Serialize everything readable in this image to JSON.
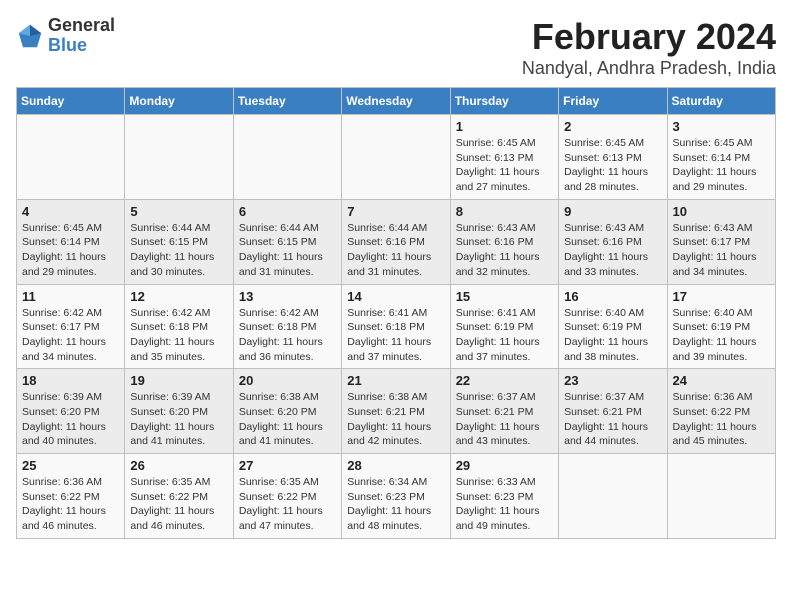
{
  "logo": {
    "text_general": "General",
    "text_blue": "Blue"
  },
  "title": "February 2024",
  "location": "Nandyal, Andhra Pradesh, India",
  "days_of_week": [
    "Sunday",
    "Monday",
    "Tuesday",
    "Wednesday",
    "Thursday",
    "Friday",
    "Saturday"
  ],
  "weeks": [
    [
      {
        "day": "",
        "info": ""
      },
      {
        "day": "",
        "info": ""
      },
      {
        "day": "",
        "info": ""
      },
      {
        "day": "",
        "info": ""
      },
      {
        "day": "1",
        "info": "Sunrise: 6:45 AM\nSunset: 6:13 PM\nDaylight: 11 hours\nand 27 minutes."
      },
      {
        "day": "2",
        "info": "Sunrise: 6:45 AM\nSunset: 6:13 PM\nDaylight: 11 hours\nand 28 minutes."
      },
      {
        "day": "3",
        "info": "Sunrise: 6:45 AM\nSunset: 6:14 PM\nDaylight: 11 hours\nand 29 minutes."
      }
    ],
    [
      {
        "day": "4",
        "info": "Sunrise: 6:45 AM\nSunset: 6:14 PM\nDaylight: 11 hours\nand 29 minutes."
      },
      {
        "day": "5",
        "info": "Sunrise: 6:44 AM\nSunset: 6:15 PM\nDaylight: 11 hours\nand 30 minutes."
      },
      {
        "day": "6",
        "info": "Sunrise: 6:44 AM\nSunset: 6:15 PM\nDaylight: 11 hours\nand 31 minutes."
      },
      {
        "day": "7",
        "info": "Sunrise: 6:44 AM\nSunset: 6:16 PM\nDaylight: 11 hours\nand 31 minutes."
      },
      {
        "day": "8",
        "info": "Sunrise: 6:43 AM\nSunset: 6:16 PM\nDaylight: 11 hours\nand 32 minutes."
      },
      {
        "day": "9",
        "info": "Sunrise: 6:43 AM\nSunset: 6:16 PM\nDaylight: 11 hours\nand 33 minutes."
      },
      {
        "day": "10",
        "info": "Sunrise: 6:43 AM\nSunset: 6:17 PM\nDaylight: 11 hours\nand 34 minutes."
      }
    ],
    [
      {
        "day": "11",
        "info": "Sunrise: 6:42 AM\nSunset: 6:17 PM\nDaylight: 11 hours\nand 34 minutes."
      },
      {
        "day": "12",
        "info": "Sunrise: 6:42 AM\nSunset: 6:18 PM\nDaylight: 11 hours\nand 35 minutes."
      },
      {
        "day": "13",
        "info": "Sunrise: 6:42 AM\nSunset: 6:18 PM\nDaylight: 11 hours\nand 36 minutes."
      },
      {
        "day": "14",
        "info": "Sunrise: 6:41 AM\nSunset: 6:18 PM\nDaylight: 11 hours\nand 37 minutes."
      },
      {
        "day": "15",
        "info": "Sunrise: 6:41 AM\nSunset: 6:19 PM\nDaylight: 11 hours\nand 37 minutes."
      },
      {
        "day": "16",
        "info": "Sunrise: 6:40 AM\nSunset: 6:19 PM\nDaylight: 11 hours\nand 38 minutes."
      },
      {
        "day": "17",
        "info": "Sunrise: 6:40 AM\nSunset: 6:19 PM\nDaylight: 11 hours\nand 39 minutes."
      }
    ],
    [
      {
        "day": "18",
        "info": "Sunrise: 6:39 AM\nSunset: 6:20 PM\nDaylight: 11 hours\nand 40 minutes."
      },
      {
        "day": "19",
        "info": "Sunrise: 6:39 AM\nSunset: 6:20 PM\nDaylight: 11 hours\nand 41 minutes."
      },
      {
        "day": "20",
        "info": "Sunrise: 6:38 AM\nSunset: 6:20 PM\nDaylight: 11 hours\nand 41 minutes."
      },
      {
        "day": "21",
        "info": "Sunrise: 6:38 AM\nSunset: 6:21 PM\nDaylight: 11 hours\nand 42 minutes."
      },
      {
        "day": "22",
        "info": "Sunrise: 6:37 AM\nSunset: 6:21 PM\nDaylight: 11 hours\nand 43 minutes."
      },
      {
        "day": "23",
        "info": "Sunrise: 6:37 AM\nSunset: 6:21 PM\nDaylight: 11 hours\nand 44 minutes."
      },
      {
        "day": "24",
        "info": "Sunrise: 6:36 AM\nSunset: 6:22 PM\nDaylight: 11 hours\nand 45 minutes."
      }
    ],
    [
      {
        "day": "25",
        "info": "Sunrise: 6:36 AM\nSunset: 6:22 PM\nDaylight: 11 hours\nand 46 minutes."
      },
      {
        "day": "26",
        "info": "Sunrise: 6:35 AM\nSunset: 6:22 PM\nDaylight: 11 hours\nand 46 minutes."
      },
      {
        "day": "27",
        "info": "Sunrise: 6:35 AM\nSunset: 6:22 PM\nDaylight: 11 hours\nand 47 minutes."
      },
      {
        "day": "28",
        "info": "Sunrise: 6:34 AM\nSunset: 6:23 PM\nDaylight: 11 hours\nand 48 minutes."
      },
      {
        "day": "29",
        "info": "Sunrise: 6:33 AM\nSunset: 6:23 PM\nDaylight: 11 hours\nand 49 minutes."
      },
      {
        "day": "",
        "info": ""
      },
      {
        "day": "",
        "info": ""
      }
    ]
  ]
}
